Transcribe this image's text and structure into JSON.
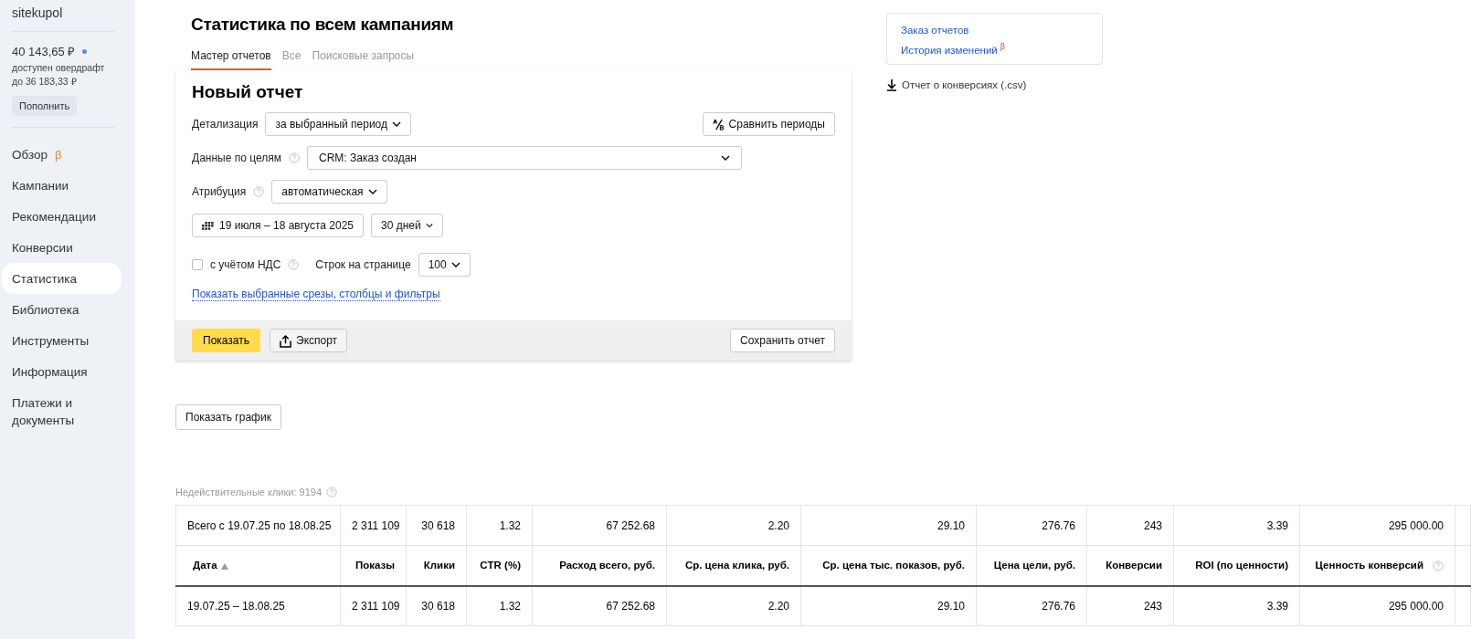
{
  "sidebar": {
    "account": "sitekupol",
    "balance": "40 143,65 ₽",
    "overdraft": "доступен овердрафт до 36 183,33 ₽",
    "topup_button": "Пополнить",
    "items": [
      {
        "label": "Обзор",
        "badge": "β",
        "selected": false
      },
      {
        "label": "Кампании",
        "selected": false
      },
      {
        "label": "Рекомендации",
        "selected": false
      },
      {
        "label": "Конверсии",
        "selected": false
      },
      {
        "label": "Статистика",
        "selected": true
      },
      {
        "label": "Библиотека",
        "selected": false
      },
      {
        "label": "Инструменты",
        "selected": false
      },
      {
        "label": "Информация",
        "selected": false
      },
      {
        "label": "Платежи и документы",
        "selected": false
      }
    ]
  },
  "page_title": "Статистика по всем кампаниям",
  "tabs": [
    {
      "label": "Мастер отчетов",
      "selected": true
    },
    {
      "label": "Все",
      "selected": false
    },
    {
      "label": "Поисковые запросы",
      "selected": false
    }
  ],
  "report": {
    "title": "Новый отчет",
    "detail_label": "Детализация",
    "detail_value": "за выбранный период",
    "compare_button": "Сравнить периоды",
    "goals_label": "Данные по целям",
    "goals_value": "CRM: Заказ создан",
    "attribution_label": "Атрибуция",
    "attribution_value": "автоматическая",
    "date_range": "19 июля – 18 августа 2025",
    "period": "30 дней",
    "vat": {
      "label": "с учётом НДС",
      "checked": false
    },
    "rows_label": "Строк на странице",
    "rows_value": "100",
    "show_filters_link": "Показать выбранные срезы, столбцы и фильтры",
    "show_button": "Показать",
    "export_button": "Экспорт",
    "save_button": "Сохранить отчет"
  },
  "side_links": [
    {
      "label": "Заказ отчетов"
    },
    {
      "label": "История изменений",
      "badge": "β"
    }
  ],
  "csv_link": "Отчет о конверсиях (.csv)",
  "chart_button": "Показать график",
  "invalid_clicks": "Недействительные клики: 9194",
  "table": {
    "summary": [
      "Всего с 19.07.25 по 18.08.25",
      "2 311 109",
      "30 618",
      "1.32",
      "67 252.68",
      "2.20",
      "29.10",
      "276.76",
      "243",
      "3.39",
      "295 000.00"
    ],
    "columns": [
      {
        "label": "Дата",
        "sorted": true
      },
      {
        "label": "Показы",
        "sorted": false
      },
      {
        "label": "Клики",
        "sorted": false
      },
      {
        "label": "CTR (%)",
        "sorted": false
      },
      {
        "label": "Расход всего, руб.",
        "sorted": false
      },
      {
        "label": "Ср. цена клика, руб.",
        "sorted": false
      },
      {
        "label": "Ср. цена тыс. показов, руб.",
        "sorted": false
      },
      {
        "label": "Цена цели, руб.",
        "sorted": false
      },
      {
        "label": "Конверсии",
        "sorted": false
      },
      {
        "label": "ROI (по ценности)",
        "sorted": false
      },
      {
        "label": "Ценность конверсий",
        "sorted": false,
        "help": true
      }
    ],
    "rows": [
      [
        "19.07.25 – 18.08.25",
        "2 311 109",
        "30 618",
        "1.32",
        "67 252.68",
        "2.20",
        "29.10",
        "276.76",
        "243",
        "3.39",
        "295 000.00"
      ]
    ]
  }
}
